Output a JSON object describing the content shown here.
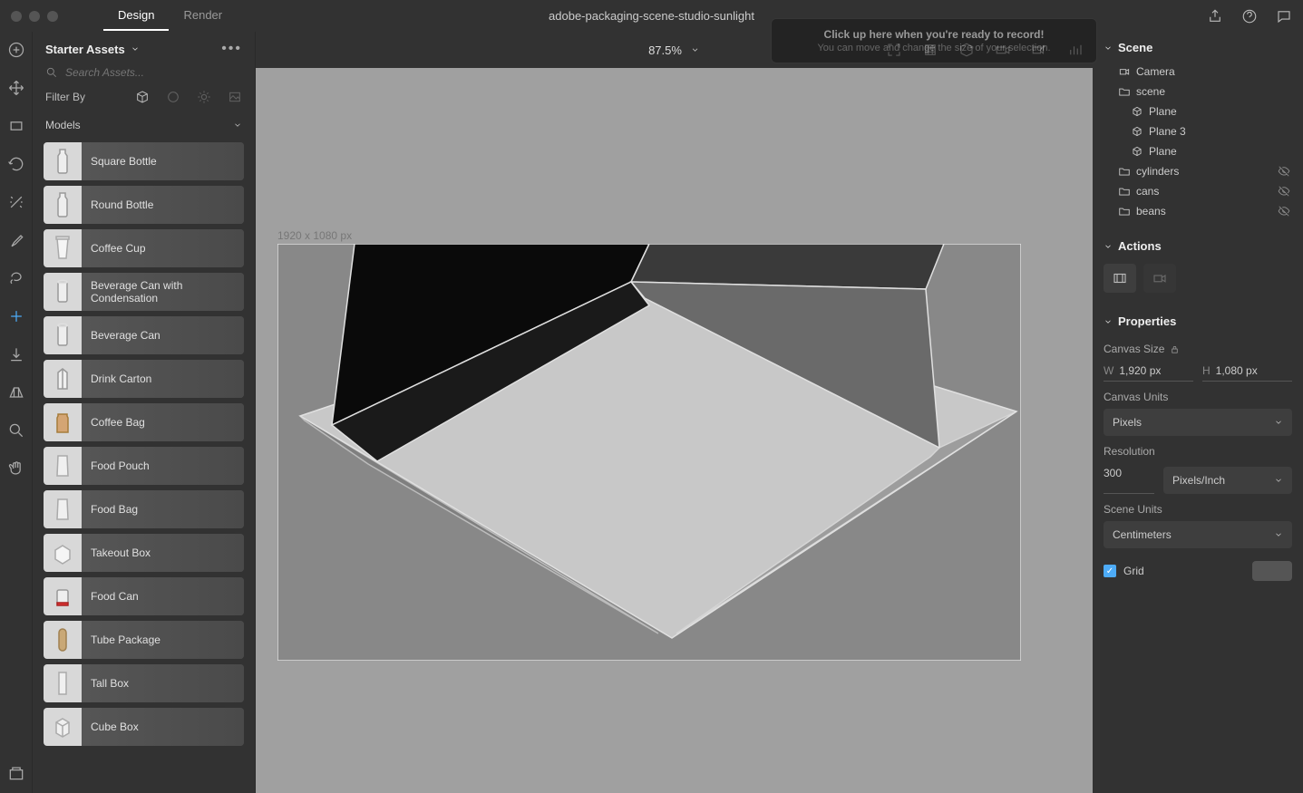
{
  "app": {
    "title": "adobe-packaging-scene-studio-sunlight"
  },
  "tabs": [
    {
      "label": "Design",
      "active": true
    },
    {
      "label": "Render",
      "active": false
    }
  ],
  "tooltip": {
    "heading": "Click up here when you're ready to record!",
    "sub": "You can move and change the size of your selection."
  },
  "tool_rail": [
    "add",
    "move",
    "frame",
    "rotate",
    "wand",
    "eyedropper",
    "lasso",
    "plus",
    "down-arrow",
    "perspective",
    "search",
    "hand"
  ],
  "left_panel": {
    "title": "Starter Assets",
    "search_placeholder": "Search Assets...",
    "filter_label": "Filter By",
    "dropdown_label": "Models",
    "assets": [
      {
        "label": "Square Bottle",
        "shape": "bottle"
      },
      {
        "label": "Round Bottle",
        "shape": "bottle"
      },
      {
        "label": "Coffee Cup",
        "shape": "cup"
      },
      {
        "label": "Beverage Can with Condensation",
        "shape": "can"
      },
      {
        "label": "Beverage Can",
        "shape": "can"
      },
      {
        "label": "Drink Carton",
        "shape": "carton"
      },
      {
        "label": "Coffee Bag",
        "shape": "bag"
      },
      {
        "label": "Food Pouch",
        "shape": "pouch"
      },
      {
        "label": "Food Bag",
        "shape": "pouch"
      },
      {
        "label": "Takeout Box",
        "shape": "box"
      },
      {
        "label": "Food Can",
        "shape": "shortcan"
      },
      {
        "label": "Tube Package",
        "shape": "tube"
      },
      {
        "label": "Tall Box",
        "shape": "tallbox"
      },
      {
        "label": "Cube Box",
        "shape": "cube"
      }
    ]
  },
  "viewport": {
    "zoom": "87.5%",
    "canvas_label": "1920 x 1080 px"
  },
  "scene": {
    "title": "Scene",
    "tree": [
      {
        "icon": "camera",
        "label": "Camera",
        "indent": 1
      },
      {
        "icon": "folder",
        "label": "scene",
        "indent": 1
      },
      {
        "icon": "mesh",
        "label": "Plane",
        "indent": 2
      },
      {
        "icon": "mesh",
        "label": "Plane 3",
        "indent": 2
      },
      {
        "icon": "mesh",
        "label": "Plane",
        "indent": 2
      },
      {
        "icon": "folder",
        "label": "cylinders",
        "indent": 1,
        "hidden": true
      },
      {
        "icon": "folder",
        "label": "cans",
        "indent": 1,
        "hidden": true
      },
      {
        "icon": "folder",
        "label": "beans",
        "indent": 1,
        "hidden": true
      }
    ]
  },
  "actions": {
    "title": "Actions"
  },
  "properties": {
    "title": "Properties",
    "canvas_size_label": "Canvas Size",
    "width_label": "W",
    "width_value": "1,920 px",
    "height_label": "H",
    "height_value": "1,080 px",
    "canvas_units_label": "Canvas Units",
    "canvas_units_value": "Pixels",
    "resolution_label": "Resolution",
    "resolution_value": "300",
    "resolution_units": "Pixels/Inch",
    "scene_units_label": "Scene Units",
    "scene_units_value": "Centimeters",
    "grid_label": "Grid"
  }
}
